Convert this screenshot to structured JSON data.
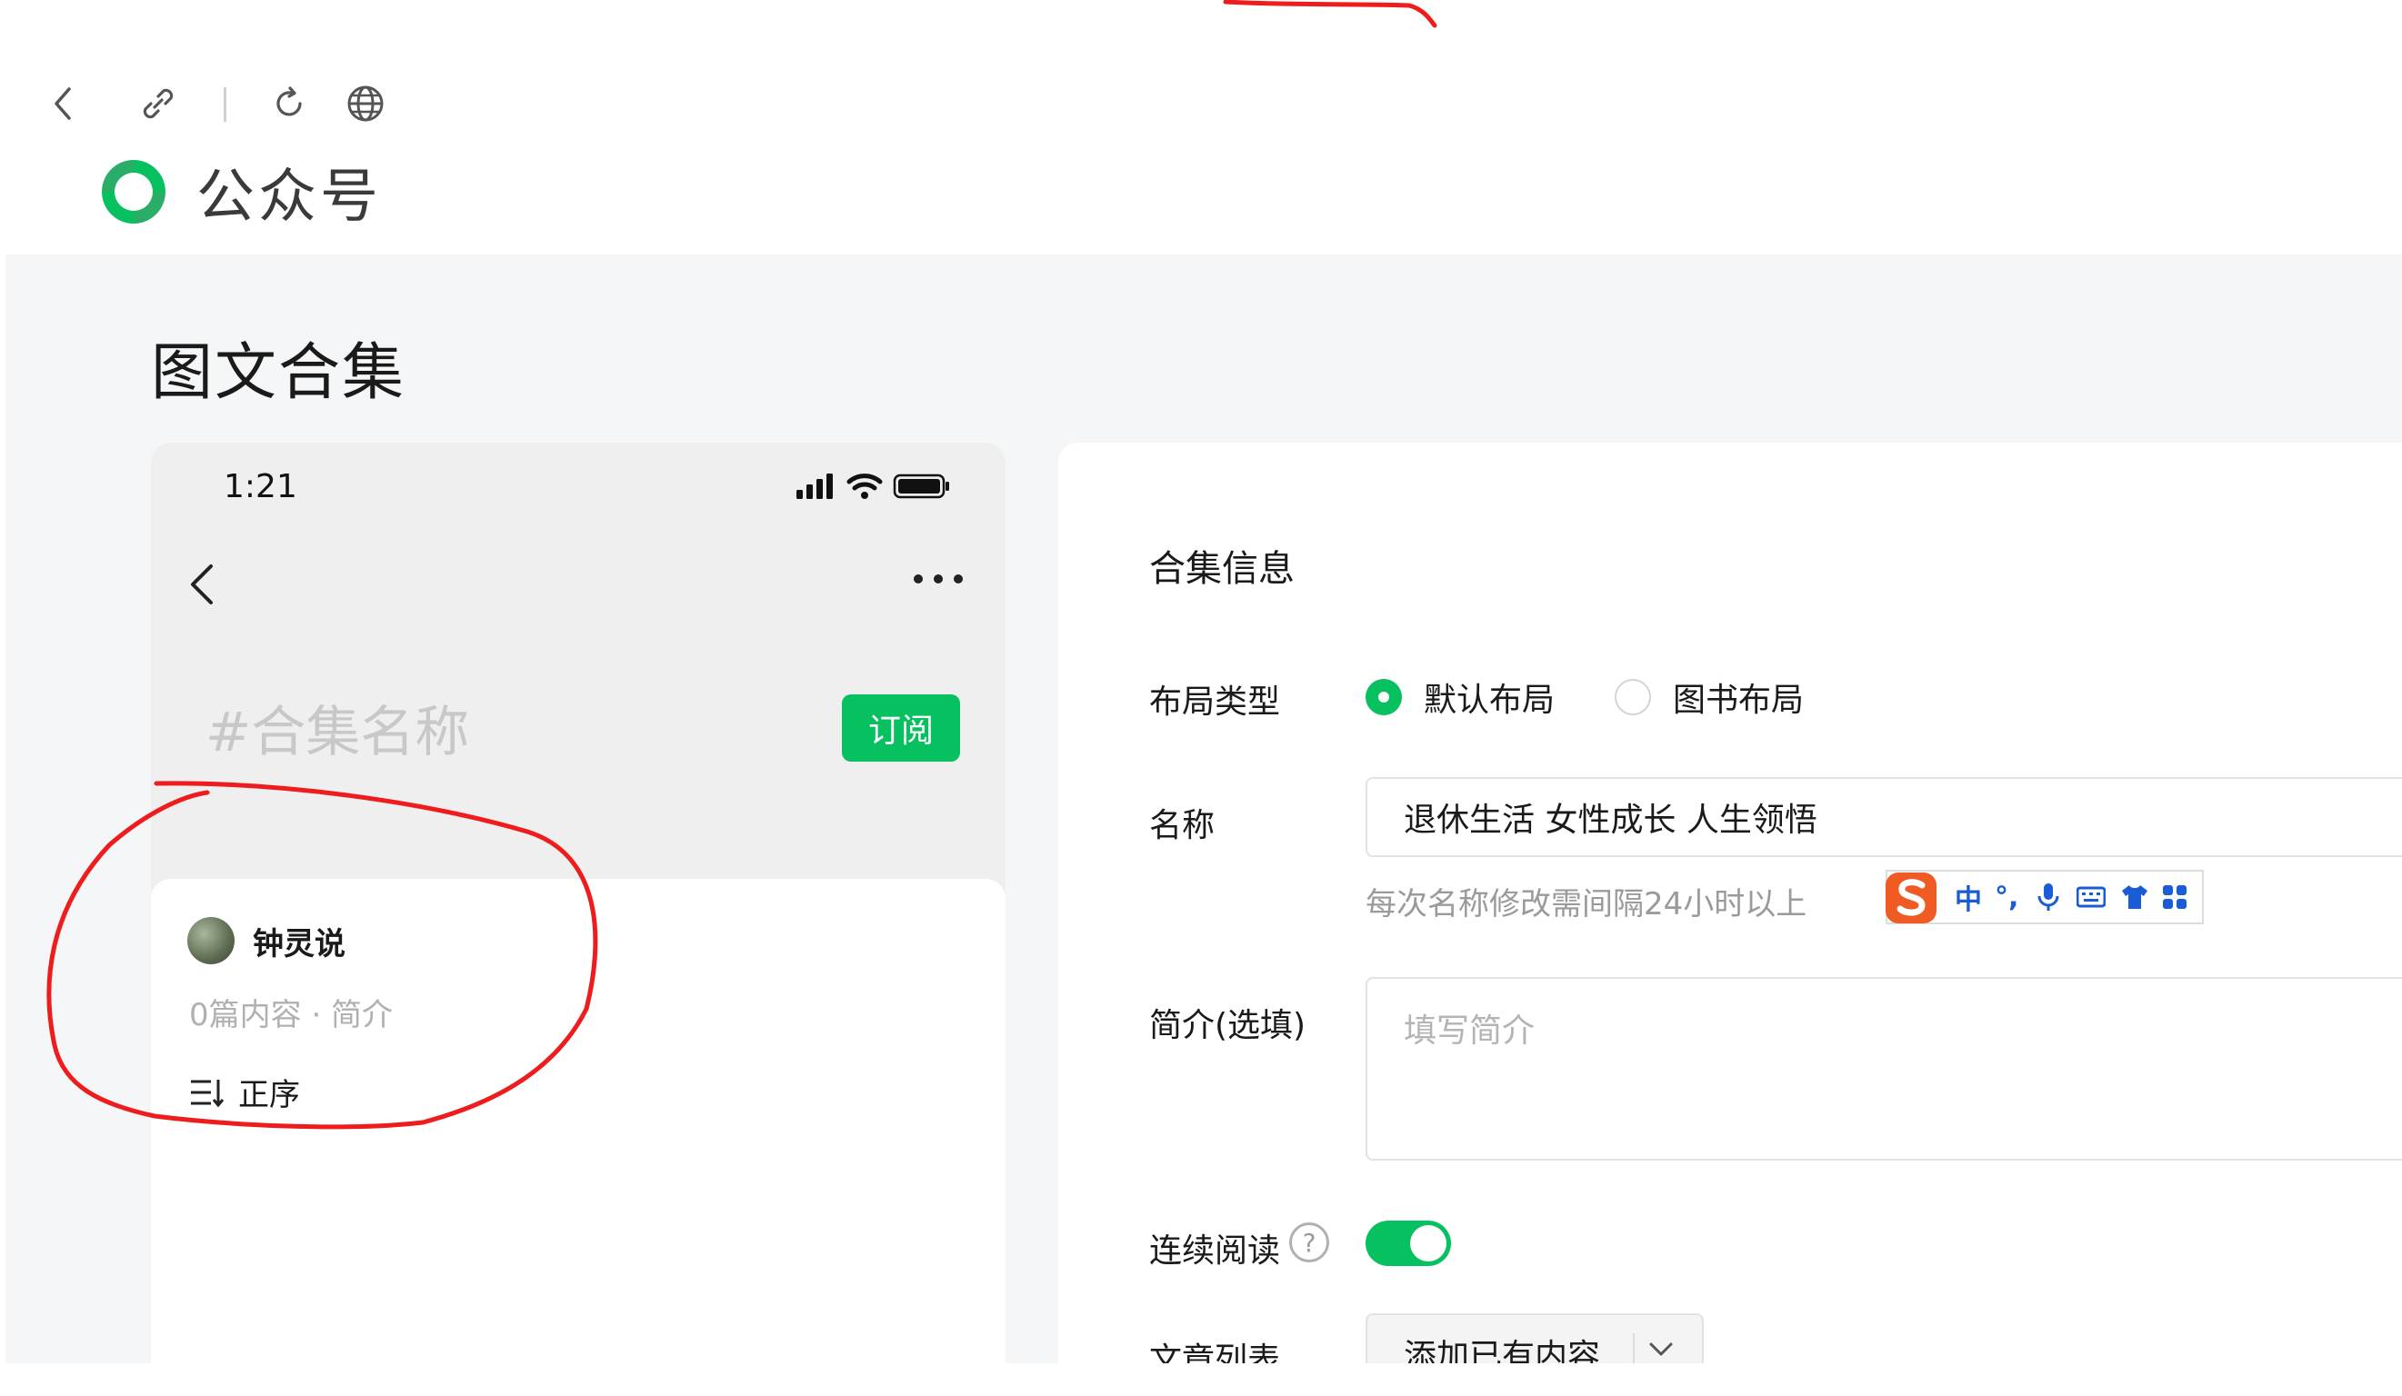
{
  "browser": {
    "icons": [
      "back-arrow-icon",
      "link-icon",
      "reload-icon",
      "globe-icon"
    ]
  },
  "brand": {
    "name": "公众号",
    "logo_color": "#07c160"
  },
  "page": {
    "title": "图文合集"
  },
  "preview": {
    "status_time": "1:21",
    "collection_name_placeholder": "#合集名称",
    "subscribe_label": "订阅",
    "author_name": "钟灵说",
    "meta": "0篇内容 · 简介",
    "order_label": "正序"
  },
  "form": {
    "section_title": "合集信息",
    "layout_label": "布局类型",
    "layout_options": [
      "默认布局",
      "图书布局"
    ],
    "layout_selected": "默认布局",
    "name_label": "名称",
    "name_value": "退休生活  女性成长 人生领悟",
    "name_hint": "每次名称修改需间隔24小时以上",
    "intro_label": "简介(选填)",
    "intro_placeholder": "填写简介",
    "continuous_label": "连续阅读",
    "continuous_on": true,
    "help_glyph": "?",
    "articles_label": "文章列表",
    "articles_select": "添加已有内容"
  },
  "ime": {
    "items": [
      "中",
      "°,"
    ]
  },
  "colors": {
    "accent": "#07c160",
    "annotation": "#ee1c1c",
    "ime_blue": "#1a5bd6"
  }
}
